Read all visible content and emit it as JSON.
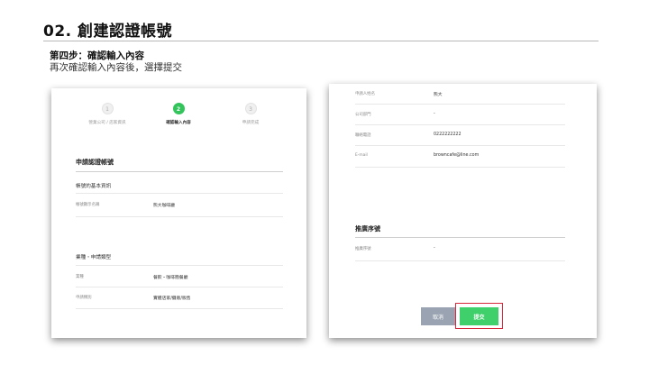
{
  "slide": {
    "title": "02. 創建認證帳號",
    "step_title": "第四步：確認輸入內容",
    "step_desc": "再次確認輸入內容後，選擇提交"
  },
  "left_panel": {
    "stepper": [
      {
        "number": "1",
        "label": "營業公司 / 店家資訊",
        "active": false
      },
      {
        "number": "2",
        "label": "確認輸入內容",
        "active": true
      },
      {
        "number": "3",
        "label": "申請完成",
        "active": false
      }
    ],
    "section_title": "申請認證帳號",
    "basic_info": {
      "heading": "帳號的基本資訊",
      "rows": [
        {
          "label": "帳號顯示名稱",
          "value": "熊大咖啡廳"
        }
      ]
    },
    "industry": {
      "heading": "業種・申請類型",
      "rows": [
        {
          "label": "業種",
          "value": "餐飲・咖啡簡餐廳"
        },
        {
          "label": "申請類別",
          "value": "實體店家/攤販/販售"
        }
      ]
    }
  },
  "right_panel": {
    "applicant_rows": [
      {
        "label": "申請人姓名",
        "value": "熊大"
      },
      {
        "label": "公司部門",
        "value": "-"
      },
      {
        "label": "聯絡電話",
        "value": "0222222222"
      },
      {
        "label": "E-mail",
        "value": "browncafe@line.com"
      }
    ],
    "promo": {
      "heading": "推廣序號",
      "rows": [
        {
          "label": "推廣序號",
          "value": "-"
        }
      ]
    },
    "buttons": {
      "cancel": "取消",
      "submit": "提交"
    }
  },
  "colors": {
    "accent_green": "#33c45c",
    "submit_green": "#3fcf6b",
    "cancel_gray": "#9aa3b1",
    "highlight_red": "#d6283a"
  }
}
